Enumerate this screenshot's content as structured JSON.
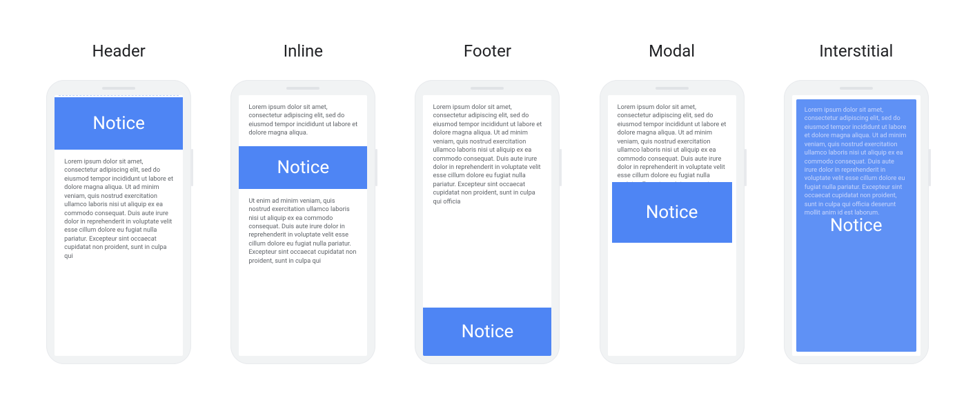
{
  "notice_label": "Notice",
  "columns": [
    {
      "title": "Header"
    },
    {
      "title": "Inline"
    },
    {
      "title": "Footer"
    },
    {
      "title": "Modal"
    },
    {
      "title": "Interstitial"
    }
  ],
  "lorem": {
    "p1": "Lorem ipsum dolor sit amet, consectetur adipiscing elit, sed do eiusmod tempor incididunt ut labore et dolore magna aliqua. Ut ad minim veniam, quis nostrud exercitation ullamco laboris nisi ut aliquip ex ea commodo consequat. Duis aute irure dolor in reprehenderit in voluptate velit esse cillum dolore eu fugiat nulla pariatur. Excepteur sint occaecat cupidatat non proident, sunt in culpa qui",
    "p_short": "Lorem ipsum dolor sit amet, consectetur adipiscing elit, sed do eiusmod tempor incididunt ut labore et dolore magna aliqua.",
    "p_after": "Ut enim ad minim veniam, quis nostrud exercitation ullamco laboris nisi ut aliquip ex ea commodo consequat. Duis aute irure dolor in reprehenderit in voluptate velit esse cillum dolore eu fugiat nulla pariatur. Excepteur sint occaecat cupidatat non proident, sunt in culpa qui",
    "p_footer": "Lorem ipsum dolor sit amet, consectetur adipiscing elit, sed do eiusmod tempor incididunt ut labore et dolore magna aliqua. Ut ad minim veniam, quis nostrud exercitation ullamco laboris nisi ut aliquip ex ea commodo consequat. Duis aute irure dolor in reprehenderit in voluptate velit esse cillum dolore eu fugiat nulla pariatur. Excepteur sint occaecat cupidatat non proident, sunt in culpa qui officia",
    "p_modal": "Lorem ipsum dolor sit amet, consectetur adipiscing elit, sed do eiusmod tempor incididunt ut labore et dolore magna aliqua. Ut ad minim veniam, quis nostrud exercitation ullamco laboris nisi ut aliquip ex ea commodo consequat. Duis aute irure dolor in reprehenderit in voluptate velit esse cillum dolore eu fugiat nulla pariatur. Excepteur sint occaecat cupidatat non proident, sunt in culpa qui officia deserunt mollit anim id est laborum.",
    "p_interstitial": "Lorem ipsum dolor sit amet, consectetur adipiscing elit, sed do eiusmod tempor incididunt ut labore et dolore magna aliqua. Ut ad minim veniam, quis nostrud exercitation ullamco laboris nisi ut aliquip ex ea commodo consequat. Duis aute irure dolor in reprehenderit in voluptate velit esse cillum dolore eu fugiat nulla pariatur. Excepteur sint occaecat cupidatat non proident, sunt in culpa qui officia deserunt mollit anim id est laborum."
  },
  "colors": {
    "notice_bg": "#4e85f4",
    "notice_text": "#ffffff",
    "body_text": "#5f6368",
    "title_text": "#202124",
    "device_bg": "#f1f3f4"
  }
}
